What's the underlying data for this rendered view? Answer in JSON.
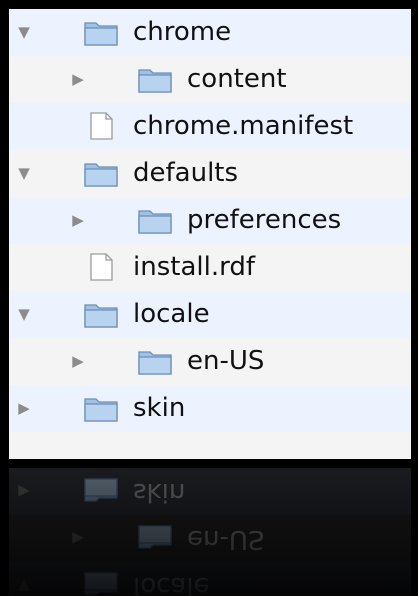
{
  "tree": {
    "rows": [
      {
        "label": "chrome",
        "type": "folder",
        "disclosure": "expanded",
        "depth": 0
      },
      {
        "label": "content",
        "type": "folder",
        "disclosure": "collapsed",
        "depth": 1
      },
      {
        "label": "chrome.manifest",
        "type": "file",
        "disclosure": "none",
        "depth": 0
      },
      {
        "label": "defaults",
        "type": "folder",
        "disclosure": "expanded",
        "depth": 0
      },
      {
        "label": "preferences",
        "type": "folder",
        "disclosure": "collapsed",
        "depth": 1
      },
      {
        "label": "install.rdf",
        "type": "file",
        "disclosure": "none",
        "depth": 0
      },
      {
        "label": "locale",
        "type": "folder",
        "disclosure": "expanded",
        "depth": 0
      },
      {
        "label": "en-US",
        "type": "folder",
        "disclosure": "collapsed",
        "depth": 1
      },
      {
        "label": "skin",
        "type": "folder",
        "disclosure": "collapsed",
        "depth": 0
      }
    ]
  },
  "icons": {
    "folder": "folder-icon",
    "file": "document-icon",
    "expanded": "disclosure-triangle-down-icon",
    "collapsed": "disclosure-triangle-right-icon"
  },
  "colors": {
    "background": "#000000",
    "list_background": "#f4f4f4",
    "alternate_row": "#edf3fe",
    "folder_fill": "#9fc1e6"
  }
}
